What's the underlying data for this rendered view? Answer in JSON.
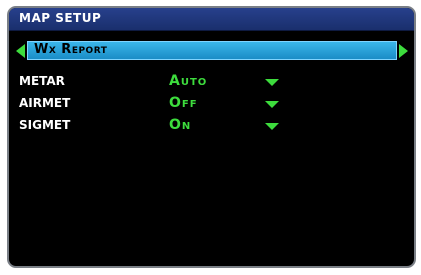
{
  "window": {
    "title": "MAP SETUP"
  },
  "selector": {
    "value": "Wx Report"
  },
  "colors": {
    "accent": "#3ddc3d",
    "title_bar": "#27408c",
    "selector_field": "#2aa8e0"
  },
  "rows": [
    {
      "label": "METAR",
      "value": "Auto"
    },
    {
      "label": "AIRMET",
      "value": "Off"
    },
    {
      "label": "SIGMET",
      "value": "On"
    }
  ]
}
